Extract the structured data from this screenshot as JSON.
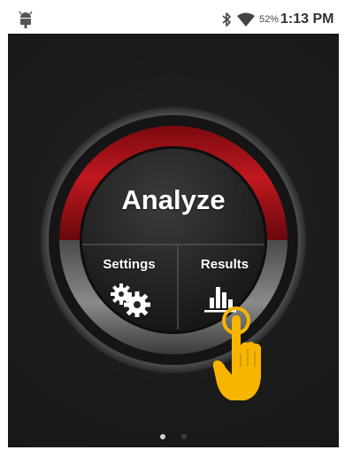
{
  "status_bar": {
    "battery": "52%",
    "time": "1:13 PM",
    "icons": [
      "android-icon",
      "bluetooth-icon",
      "wifi-icon"
    ]
  },
  "dial": {
    "analyze_label": "Analyze",
    "settings_label": "Settings",
    "results_label": "Results",
    "icons": [
      "gear-icon",
      "bar-chart-icon",
      "pointing-hand-icon"
    ]
  },
  "pager": {
    "pages": 2,
    "active_page": 1
  },
  "colors": {
    "background": "#1b1b1b",
    "accent_red": "#b3121a",
    "status_bar": "#ffffff",
    "hand_yellow": "#f7b500"
  }
}
